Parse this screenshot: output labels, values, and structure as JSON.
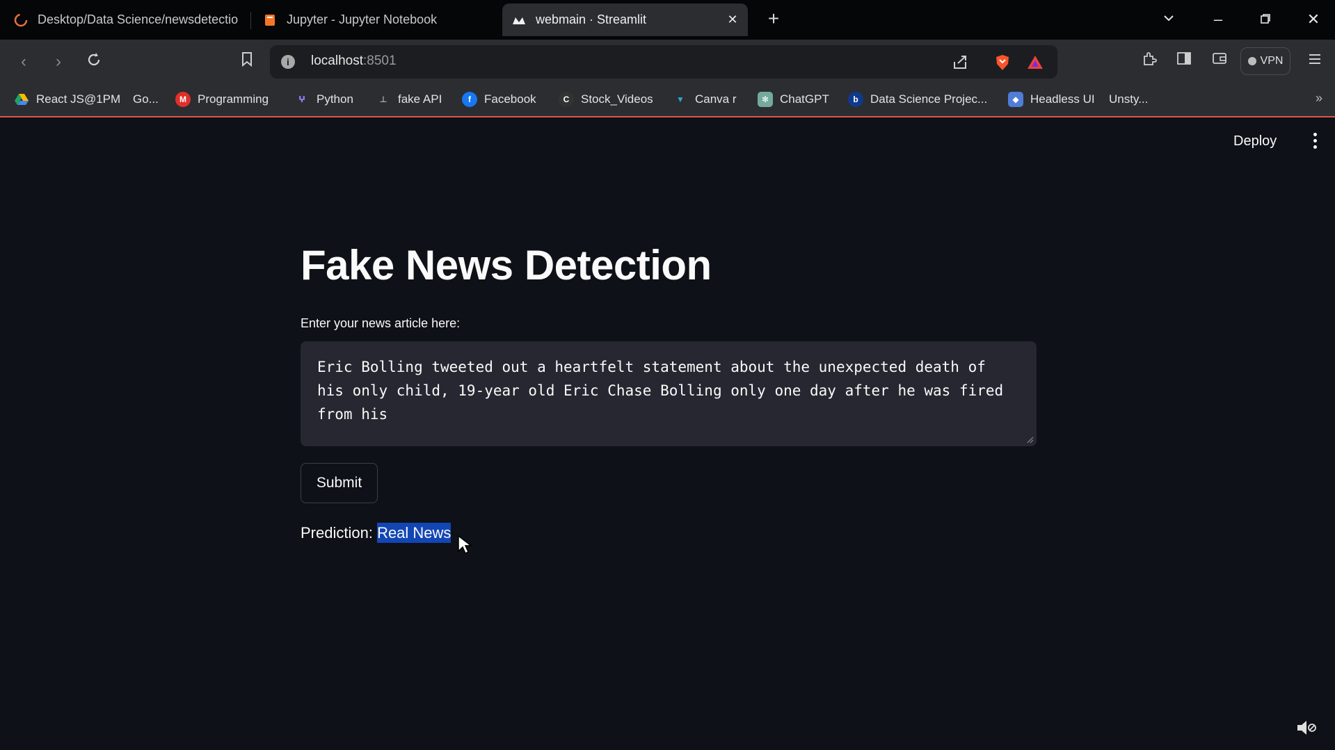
{
  "browser": {
    "tabs": [
      {
        "title": "Desktop/Data Science/newsdetectio",
        "active": false
      },
      {
        "title": "Jupyter - Jupyter Notebook",
        "active": false
      },
      {
        "title": "webmain · Streamlit",
        "active": true
      }
    ],
    "url_host": "localhost",
    "url_port": ":8501",
    "vpn_label": "VPN",
    "bookmarks": [
      {
        "label": "React JS@1PM",
        "icon": "google-drive-icon",
        "color": "#1fa463"
      },
      {
        "label": "Go...",
        "icon": "",
        "color": ""
      },
      {
        "label": "Programming",
        "icon": "m-logo-icon",
        "color": "#e0302a"
      },
      {
        "label": "Python",
        "icon": "python-icon",
        "color": "#6a5acd"
      },
      {
        "label": "fake API",
        "icon": "api-icon",
        "color": "#555555"
      },
      {
        "label": "Facebook",
        "icon": "facebook-icon",
        "color": "#1877f2"
      },
      {
        "label": "Stock_Videos",
        "icon": "c-logo-icon",
        "color": "#444444"
      },
      {
        "label": "Canva r",
        "icon": "canva-icon",
        "color": "#2aa7d8"
      },
      {
        "label": "ChatGPT",
        "icon": "chatgpt-icon",
        "color": "#74aa9c"
      },
      {
        "label": "Data Science Projec...",
        "icon": "b-logo-icon",
        "color": "#0f3a8c"
      },
      {
        "label": "Headless UI",
        "icon": "headless-ui-icon",
        "color": "#4f7dd8"
      },
      {
        "label": "Unsty...",
        "icon": "",
        "color": ""
      }
    ]
  },
  "app": {
    "deploy_label": "Deploy",
    "title": "Fake News Detection",
    "input_label": "Enter your news article here:",
    "article_text": "Eric Bolling tweeted out a heartfelt statement about the unexpected death of his only child, 19-year old Eric Chase Bolling only one day after he was fired from his",
    "submit_label": "Submit",
    "prediction_label": "Prediction: ",
    "prediction_value": "Real News",
    "highlight_color": "#1346b5"
  }
}
